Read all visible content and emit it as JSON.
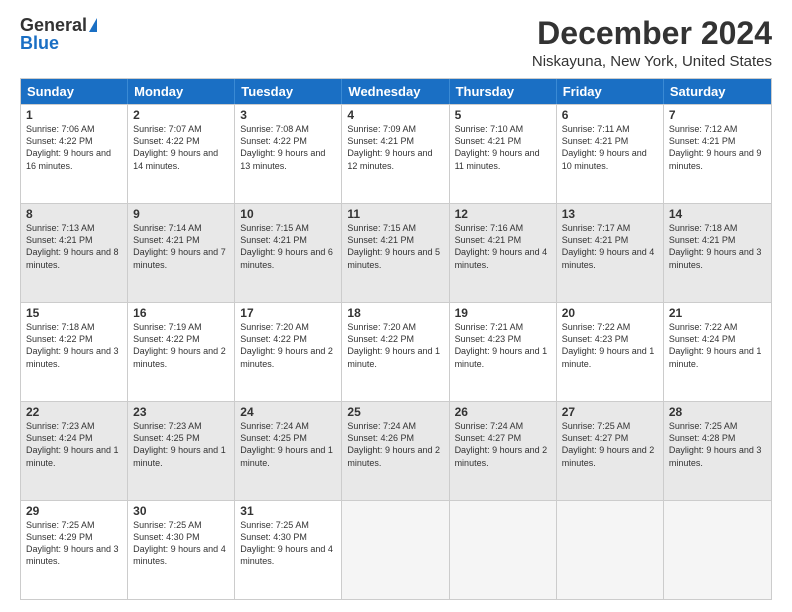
{
  "header": {
    "logo_general": "General",
    "logo_blue": "Blue",
    "title": "December 2024",
    "subtitle": "Niskayuna, New York, United States"
  },
  "days_of_week": [
    "Sunday",
    "Monday",
    "Tuesday",
    "Wednesday",
    "Thursday",
    "Friday",
    "Saturday"
  ],
  "weeks": [
    [
      {
        "day": "1",
        "info": "Sunrise: 7:06 AM\nSunset: 4:22 PM\nDaylight: 9 hours and 16 minutes.",
        "shaded": false
      },
      {
        "day": "2",
        "info": "Sunrise: 7:07 AM\nSunset: 4:22 PM\nDaylight: 9 hours and 14 minutes.",
        "shaded": false
      },
      {
        "day": "3",
        "info": "Sunrise: 7:08 AM\nSunset: 4:22 PM\nDaylight: 9 hours and 13 minutes.",
        "shaded": false
      },
      {
        "day": "4",
        "info": "Sunrise: 7:09 AM\nSunset: 4:21 PM\nDaylight: 9 hours and 12 minutes.",
        "shaded": false
      },
      {
        "day": "5",
        "info": "Sunrise: 7:10 AM\nSunset: 4:21 PM\nDaylight: 9 hours and 11 minutes.",
        "shaded": false
      },
      {
        "day": "6",
        "info": "Sunrise: 7:11 AM\nSunset: 4:21 PM\nDaylight: 9 hours and 10 minutes.",
        "shaded": false
      },
      {
        "day": "7",
        "info": "Sunrise: 7:12 AM\nSunset: 4:21 PM\nDaylight: 9 hours and 9 minutes.",
        "shaded": false
      }
    ],
    [
      {
        "day": "8",
        "info": "Sunrise: 7:13 AM\nSunset: 4:21 PM\nDaylight: 9 hours and 8 minutes.",
        "shaded": true
      },
      {
        "day": "9",
        "info": "Sunrise: 7:14 AM\nSunset: 4:21 PM\nDaylight: 9 hours and 7 minutes.",
        "shaded": true
      },
      {
        "day": "10",
        "info": "Sunrise: 7:15 AM\nSunset: 4:21 PM\nDaylight: 9 hours and 6 minutes.",
        "shaded": true
      },
      {
        "day": "11",
        "info": "Sunrise: 7:15 AM\nSunset: 4:21 PM\nDaylight: 9 hours and 5 minutes.",
        "shaded": true
      },
      {
        "day": "12",
        "info": "Sunrise: 7:16 AM\nSunset: 4:21 PM\nDaylight: 9 hours and 4 minutes.",
        "shaded": true
      },
      {
        "day": "13",
        "info": "Sunrise: 7:17 AM\nSunset: 4:21 PM\nDaylight: 9 hours and 4 minutes.",
        "shaded": true
      },
      {
        "day": "14",
        "info": "Sunrise: 7:18 AM\nSunset: 4:21 PM\nDaylight: 9 hours and 3 minutes.",
        "shaded": true
      }
    ],
    [
      {
        "day": "15",
        "info": "Sunrise: 7:18 AM\nSunset: 4:22 PM\nDaylight: 9 hours and 3 minutes.",
        "shaded": false
      },
      {
        "day": "16",
        "info": "Sunrise: 7:19 AM\nSunset: 4:22 PM\nDaylight: 9 hours and 2 minutes.",
        "shaded": false
      },
      {
        "day": "17",
        "info": "Sunrise: 7:20 AM\nSunset: 4:22 PM\nDaylight: 9 hours and 2 minutes.",
        "shaded": false
      },
      {
        "day": "18",
        "info": "Sunrise: 7:20 AM\nSunset: 4:22 PM\nDaylight: 9 hours and 1 minute.",
        "shaded": false
      },
      {
        "day": "19",
        "info": "Sunrise: 7:21 AM\nSunset: 4:23 PM\nDaylight: 9 hours and 1 minute.",
        "shaded": false
      },
      {
        "day": "20",
        "info": "Sunrise: 7:22 AM\nSunset: 4:23 PM\nDaylight: 9 hours and 1 minute.",
        "shaded": false
      },
      {
        "day": "21",
        "info": "Sunrise: 7:22 AM\nSunset: 4:24 PM\nDaylight: 9 hours and 1 minute.",
        "shaded": false
      }
    ],
    [
      {
        "day": "22",
        "info": "Sunrise: 7:23 AM\nSunset: 4:24 PM\nDaylight: 9 hours and 1 minute.",
        "shaded": true
      },
      {
        "day": "23",
        "info": "Sunrise: 7:23 AM\nSunset: 4:25 PM\nDaylight: 9 hours and 1 minute.",
        "shaded": true
      },
      {
        "day": "24",
        "info": "Sunrise: 7:24 AM\nSunset: 4:25 PM\nDaylight: 9 hours and 1 minute.",
        "shaded": true
      },
      {
        "day": "25",
        "info": "Sunrise: 7:24 AM\nSunset: 4:26 PM\nDaylight: 9 hours and 2 minutes.",
        "shaded": true
      },
      {
        "day": "26",
        "info": "Sunrise: 7:24 AM\nSunset: 4:27 PM\nDaylight: 9 hours and 2 minutes.",
        "shaded": true
      },
      {
        "day": "27",
        "info": "Sunrise: 7:25 AM\nSunset: 4:27 PM\nDaylight: 9 hours and 2 minutes.",
        "shaded": true
      },
      {
        "day": "28",
        "info": "Sunrise: 7:25 AM\nSunset: 4:28 PM\nDaylight: 9 hours and 3 minutes.",
        "shaded": true
      }
    ],
    [
      {
        "day": "29",
        "info": "Sunrise: 7:25 AM\nSunset: 4:29 PM\nDaylight: 9 hours and 3 minutes.",
        "shaded": false
      },
      {
        "day": "30",
        "info": "Sunrise: 7:25 AM\nSunset: 4:30 PM\nDaylight: 9 hours and 4 minutes.",
        "shaded": false
      },
      {
        "day": "31",
        "info": "Sunrise: 7:25 AM\nSunset: 4:30 PM\nDaylight: 9 hours and 4 minutes.",
        "shaded": false
      },
      {
        "day": "",
        "info": "",
        "shaded": false,
        "empty": true
      },
      {
        "day": "",
        "info": "",
        "shaded": false,
        "empty": true
      },
      {
        "day": "",
        "info": "",
        "shaded": false,
        "empty": true
      },
      {
        "day": "",
        "info": "",
        "shaded": false,
        "empty": true
      }
    ]
  ]
}
